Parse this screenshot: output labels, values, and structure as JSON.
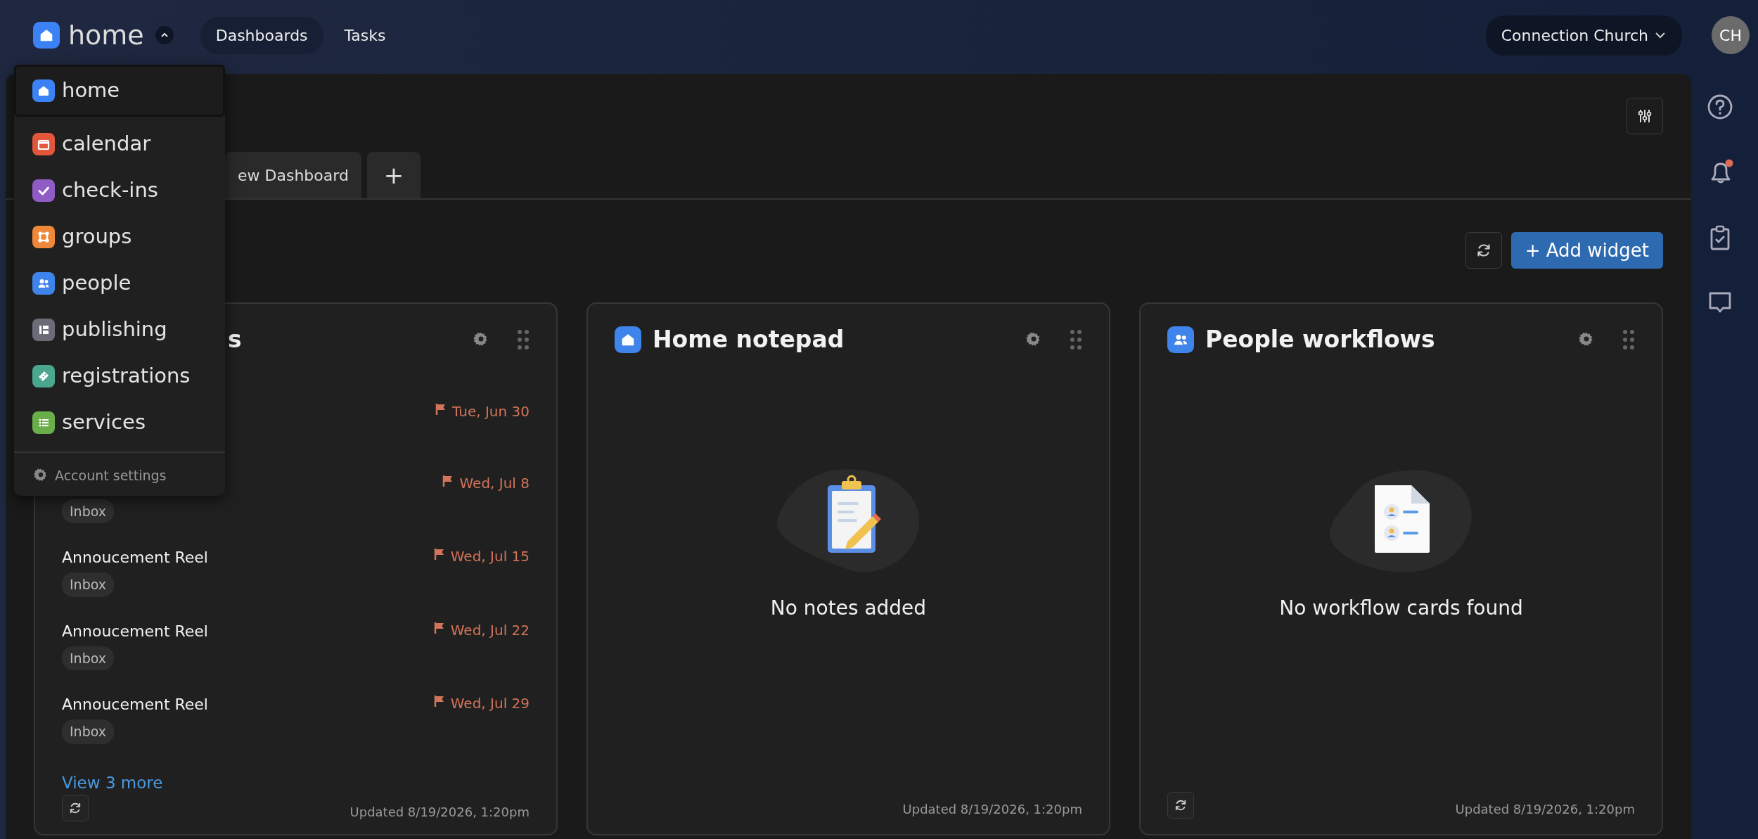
{
  "app_switcher": {
    "label": "home",
    "expanded": true
  },
  "nav": [
    {
      "label": "Dashboards",
      "selected": true
    },
    {
      "label": "Tasks",
      "selected": false
    }
  ],
  "org_menu": {
    "label": "Connection Church"
  },
  "avatar": {
    "initials": "CH"
  },
  "notifications": {
    "unread": true
  },
  "app_menu": {
    "items": [
      {
        "label": "home",
        "kind": "home",
        "color": "#3b82f6",
        "selected": true
      },
      {
        "label": "calendar",
        "kind": "calendar",
        "color": "#e0573c",
        "selected": false
      },
      {
        "label": "check-ins",
        "kind": "checkins",
        "color": "#8e5cc4",
        "selected": false
      },
      {
        "label": "groups",
        "kind": "groups",
        "color": "#f0883a",
        "selected": false
      },
      {
        "label": "people",
        "kind": "people",
        "color": "#3f84ea",
        "selected": false
      },
      {
        "label": "publishing",
        "kind": "publishing",
        "color": "#6c6c78",
        "selected": false
      },
      {
        "label": "registrations",
        "kind": "registrations",
        "color": "#4aa68e",
        "selected": false
      },
      {
        "label": "services",
        "kind": "services",
        "color": "#6aae4a",
        "selected": false
      }
    ],
    "footer": "Account settings"
  },
  "dashboard_tabs": [
    {
      "label": "ew Dashboard",
      "kind": "tab",
      "selected": false
    },
    {
      "label": "+",
      "kind": "add",
      "selected": false
    }
  ],
  "add_widget": {
    "label": "+ Add widget"
  },
  "widgets": [
    {
      "kind": "tasks",
      "title": "s",
      "refresh_button": true,
      "rows": [
        {
          "due": "Tue, Jun 30"
        },
        {
          "tag": "Inbox",
          "due": "Wed, Jul 8"
        },
        {
          "title": "Annoucement Reel",
          "tag": "Inbox",
          "due": "Wed, Jul 15"
        },
        {
          "title": "Annoucement Reel",
          "tag": "Inbox",
          "due": "Wed, Jul 22"
        },
        {
          "title": "Annoucement Reel",
          "tag": "Inbox",
          "due": "Wed, Jul 29"
        }
      ],
      "link": "View 3 more",
      "updated": "Updated 8/19/2026, 1:20pm"
    },
    {
      "kind": "notes",
      "title": "Home notepad",
      "message": "No notes added",
      "refresh_button": false,
      "updated": "Updated 8/19/2026, 1:20pm"
    },
    {
      "kind": "workflows",
      "title": "People workflows",
      "message": "No workflow cards found",
      "refresh_button": true,
      "updated": "Updated 8/19/2026, 1:20pm"
    }
  ]
}
